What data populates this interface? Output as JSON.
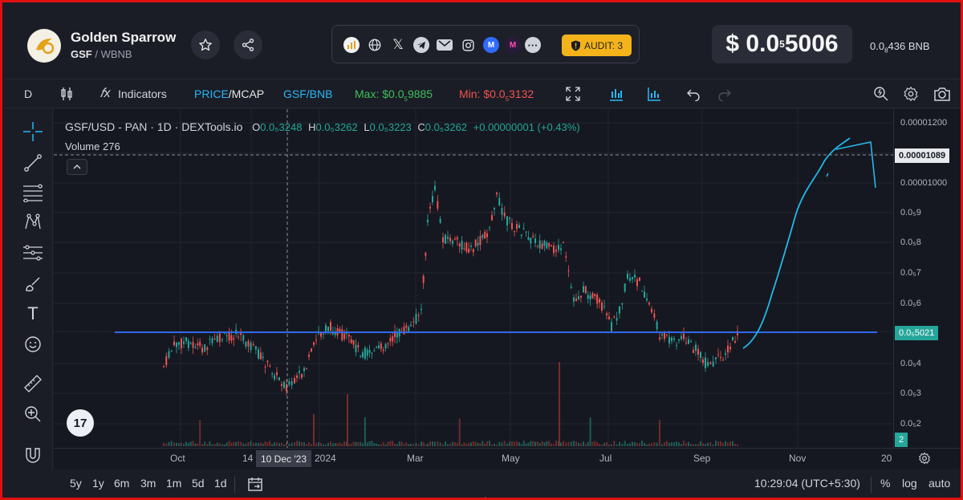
{
  "header": {
    "token_name": "Golden Sparrow",
    "pair_base": "GSF",
    "pair_sep": " / ",
    "pair_quote": "WBNB",
    "audit_label": "AUDIT: 3",
    "price_prefix": "$ 0.0",
    "price_sub": "5",
    "price_main": "5006",
    "bnb_prefix": "0.0",
    "bnb_sub": "8",
    "bnb_main": "436 BNB",
    "social_icons": [
      "cmc-icon",
      "globe-icon",
      "x-icon",
      "telegram-icon",
      "email-icon",
      "instagram-icon",
      "coinmarketcap-icon",
      "dextools-icon",
      "more-icon"
    ]
  },
  "toolbar": {
    "interval": "D",
    "indicators": "Indicators",
    "price_label": "PRICE",
    "mcap_label": "/MCAP",
    "pair_toggle": "GSF/BNB",
    "max_label": "Max: $0.0",
    "max_sub": "5",
    "max_main": "9885",
    "min_label": "Min: $0.0",
    "min_sub": "5",
    "min_main": "3132"
  },
  "legend": {
    "title": "GSF/USD - PAN · 1D · DEXTools.io",
    "o_label": "O",
    "o_val": "0.0₅3248",
    "h_label": "H",
    "h_val": "0.0₅3262",
    "l_label": "L",
    "l_val": "0.0₅3223",
    "c_label": "C",
    "c_val": "0.0₅3262",
    "change": "+0.00000001 (+0.43%)",
    "volume_label": "Volume",
    "volume_val": "276"
  },
  "price_scale": {
    "labels": [
      {
        "text": "0.00001200"
      },
      {
        "text": "0.00001000"
      },
      {
        "text": "0.0₅9"
      },
      {
        "text": "0.0₅8"
      },
      {
        "text": "0.0₅7"
      },
      {
        "text": "0.0₅6"
      },
      {
        "text": "0.0₅4"
      },
      {
        "text": "0.0₅3"
      },
      {
        "text": "0.0₅2"
      }
    ],
    "crosshair_tag": "0.00001089",
    "current_tag": "0.0₅5021",
    "volume_tag": "2"
  },
  "time_axis": {
    "ticks": [
      "Oct",
      "14",
      "2024",
      "Mar",
      "May",
      "Jul",
      "Sep",
      "Nov",
      "20"
    ],
    "crosshair_date": "10 Dec '23"
  },
  "bottom": {
    "ranges": [
      "5y",
      "1y",
      "6m",
      "3m",
      "1m",
      "5d",
      "1d"
    ],
    "clock": "10:29:04 (UTC+5:30)",
    "percent": "%",
    "log": "log",
    "auto": "auto"
  },
  "colors": {
    "up": "#26a69a",
    "down": "#ef5350",
    "hline": "#2f6bff",
    "drawing": "#23b8e6",
    "audit": "#f4b31b"
  }
}
